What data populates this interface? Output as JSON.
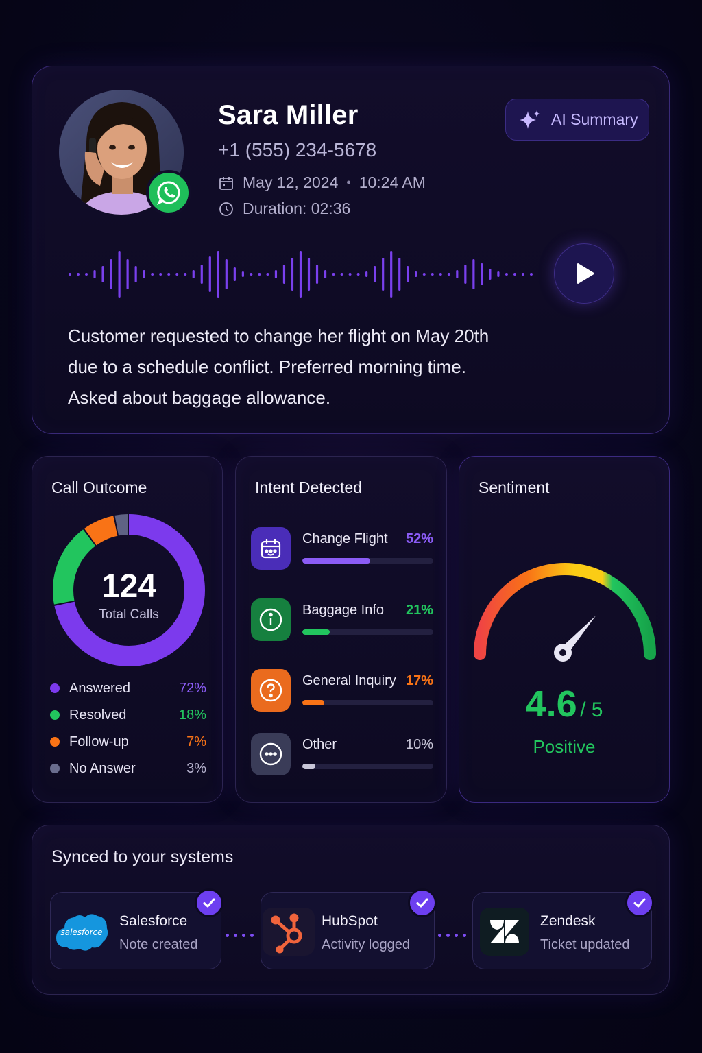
{
  "contact": {
    "name": "Sara Miller",
    "phone": "+1 (555) 234-5678",
    "date": "May 12, 2024",
    "time": "10:24 AM",
    "duration": "Duration: 02:36",
    "channel_icon": "whatsapp-icon"
  },
  "ai_summary": {
    "label": "AI Summary",
    "icon": "sparkle-icon"
  },
  "call_summary": [
    "Customer requested to change her flight on May 20th",
    "due to a schedule conflict. Preferred morning time.",
    "Asked about baggage allowance."
  ],
  "call_outcome": {
    "title": "Call Outcome",
    "total": "124",
    "total_label": "Total Calls",
    "items": [
      {
        "label": "Answered",
        "pct": "72%",
        "value": 72,
        "color": "#7c3aed"
      },
      {
        "label": "Resolved",
        "pct": "18%",
        "value": 18,
        "color": "#22c55e"
      },
      {
        "label": "Follow-up",
        "pct": "7%",
        "value": 7,
        "color": "#f97316"
      },
      {
        "label": "No Answer",
        "pct": "3%",
        "value": 3,
        "color": "#5f6384"
      }
    ]
  },
  "intent": {
    "title": "Intent Detected",
    "items": [
      {
        "label": "Change Flight",
        "pct": "52%",
        "value": 52,
        "color": "#8b5cf6",
        "icon": "calendar-icon",
        "icon_bg": "#4a2db8"
      },
      {
        "label": "Baggage Info",
        "pct": "21%",
        "value": 21,
        "color": "#22c55e",
        "icon": "info-icon",
        "icon_bg": "#16803f"
      },
      {
        "label": "General Inquiry",
        "pct": "17%",
        "value": 17,
        "color": "#f97316",
        "icon": "question-icon",
        "icon_bg": "#e8611a"
      },
      {
        "label": "Other",
        "pct": "10%",
        "value": 10,
        "color": "#c8c6d8",
        "icon": "more-icon",
        "icon_bg": "#3a3c58"
      }
    ]
  },
  "sentiment": {
    "title": "Sentiment",
    "score": "4.6",
    "max": "/ 5",
    "score_value": 4.6,
    "label": "Positive"
  },
  "sync": {
    "title": "Synced to your systems",
    "systems": [
      {
        "name": "Salesforce",
        "status": "Note created",
        "logo_text": "salesforce",
        "icon": "salesforce-logo"
      },
      {
        "name": "HubSpot",
        "status": "Activity logged",
        "icon": "hubspot-logo"
      },
      {
        "name": "Zendesk",
        "status": "Ticket updated",
        "icon": "zendesk-logo"
      }
    ]
  },
  "colors": {
    "accent": "#7c3aed",
    "positive": "#22c55e",
    "background": "#07061a"
  }
}
